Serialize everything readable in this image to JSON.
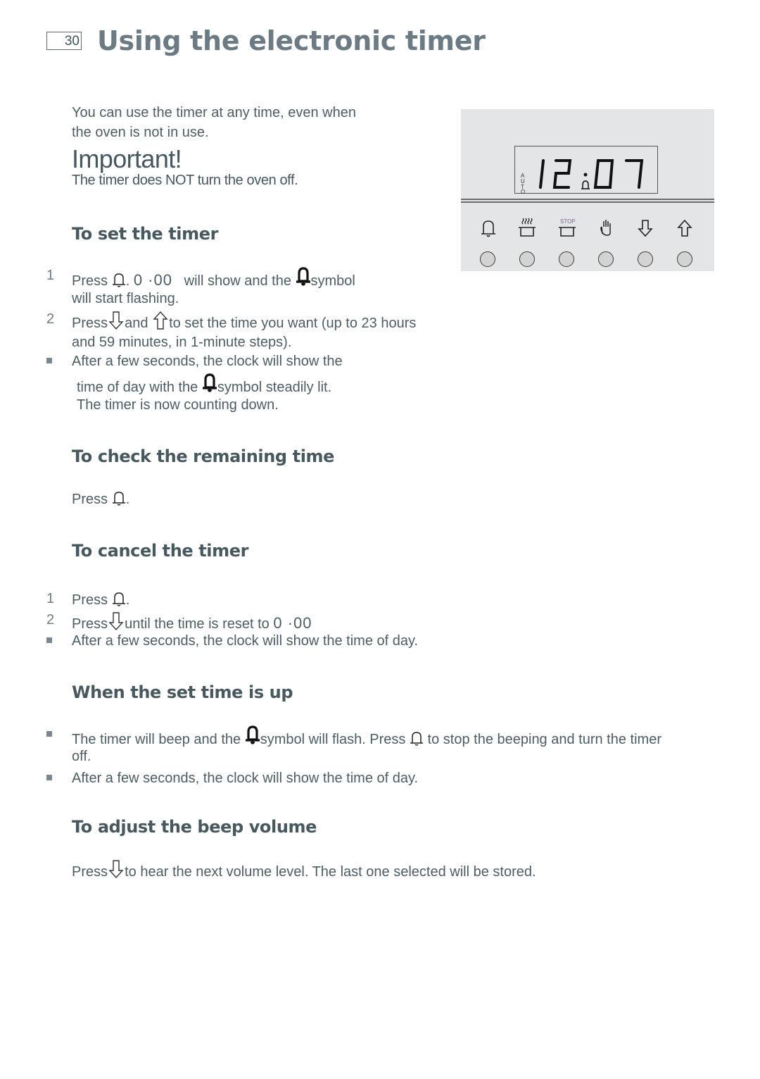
{
  "header": {
    "page_number": "30",
    "title": "Using the electronic timer"
  },
  "intro": {
    "line1": "You can use the timer at any time, even when",
    "line2": "the oven is not in use.",
    "important_label": "Important!",
    "important_note": "The timer does NOT turn the oven off."
  },
  "panel": {
    "display_time": "12:07",
    "auto_label": "AUTO",
    "stop_label": "STOP",
    "buttons": [
      {
        "icon": "bell-icon",
        "label": "Timer"
      },
      {
        "icon": "pot-steam-icon",
        "label": "Cooking time"
      },
      {
        "icon": "pot-stop-icon",
        "label": "Stop time"
      },
      {
        "icon": "hand-icon",
        "label": "Manual"
      },
      {
        "icon": "arrow-down-icon",
        "label": "Down"
      },
      {
        "icon": "arrow-up-icon",
        "label": "Up"
      }
    ],
    "colors": {
      "panel_bg": "#e4e5e6",
      "button_fill": "#d4d3d3",
      "stop_text": "#7a5f8a"
    }
  },
  "set_timer": {
    "heading": "To set the timer",
    "step1": {
      "num": "1",
      "pre": "Press",
      "mid": ". ",
      "display": "0 ·00",
      "post1": "will show and the",
      "post2": "symbol",
      "line2": "will start flashing."
    },
    "step2": {
      "num": "2",
      "pre": "Press",
      "and": "and",
      "post": "to set the time you want (up to 23 hours",
      "line2": "and 59 minutes, in 1-minute steps)."
    },
    "bullet": {
      "line1": "After a few seconds, the clock will show the",
      "line2_pre": "time of day with the",
      "line2_post": "symbol steadily lit.",
      "line3": "The timer is now counting down."
    }
  },
  "check_time": {
    "heading": "To check the remaining time",
    "text_pre": "Press",
    "text_post": "."
  },
  "cancel_timer": {
    "heading": "To cancel the timer",
    "step1": {
      "num": "1",
      "pre": "Press",
      "post": "."
    },
    "step2": {
      "num": "2",
      "pre": "Press",
      "post": "until the time is reset to",
      "display": "0 ·00"
    },
    "bullet": "After a few seconds, the clock will show the time of day."
  },
  "time_up": {
    "heading": "When the set time is up",
    "bullet1": {
      "pre": "The timer will beep and the",
      "mid": "symbol will flash. Press",
      "post": "to stop the beeping and turn the timer",
      "line2": "off."
    },
    "bullet2": "After a few seconds, the clock will show the time of day."
  },
  "beep_volume": {
    "heading": "To adjust the beep volume",
    "text_pre": "Press",
    "text_post": "to hear the next volume level. The last one selected will be stored."
  }
}
